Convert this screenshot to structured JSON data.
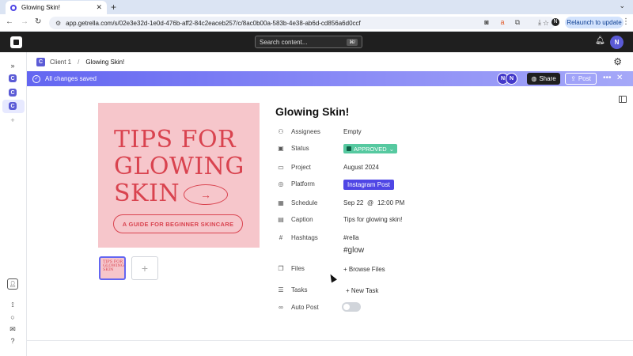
{
  "browser": {
    "tab_title": "Glowing Skin!",
    "url": "app.getrella.com/s/02e3e32d-1e0d-476b-aff2-84c2eaceb257/c/8ac0b00a-583b-4e38-ab6d-cd856a6d0ccf",
    "relaunch_label": "Relaunch to update",
    "profile_initial": "N"
  },
  "appbar": {
    "search_placeholder": "Search content...",
    "search_shortcut": "⌘/",
    "user_initial": "N"
  },
  "sidebar": {
    "items": [
      {
        "label": "C"
      },
      {
        "label": "C"
      },
      {
        "label": "C"
      }
    ],
    "add_label": "+"
  },
  "breadcrumb": {
    "workspace_initial": "C",
    "client": "Client 1",
    "separator": "/",
    "post": "Glowing Skin!"
  },
  "savedbar": {
    "text": "All changes saved",
    "avatars": [
      "N",
      "N"
    ],
    "share_label": "Share",
    "post_label": "Post"
  },
  "poster": {
    "headline": "TIPS FOR GLOWING SKIN",
    "subtitle": "A GUIDE FOR BEGINNER SKINCARE",
    "thumb_text": "TIPS FOR GLOWING SKIN"
  },
  "post": {
    "title": "Glowing Skin!",
    "fields": {
      "assignees": {
        "label": "Assignees",
        "value": "Empty"
      },
      "status": {
        "label": "Status",
        "value": "APPROVED"
      },
      "project": {
        "label": "Project",
        "value": "August 2024"
      },
      "platform": {
        "label": "Platform",
        "value": "Instagram Post"
      },
      "schedule": {
        "label": "Schedule",
        "date": "Sep 22",
        "at": "@",
        "time": "12:00 PM"
      },
      "caption": {
        "label": "Caption",
        "value": "Tips for glowing skin!"
      },
      "hashtags": {
        "label": "Hashtags",
        "values": [
          "#rella",
          "#glow"
        ]
      },
      "files": {
        "label": "Files",
        "value": "+ Browse Files"
      },
      "tasks": {
        "label": "Tasks",
        "value": "+ New Task"
      },
      "autopost": {
        "label": "Auto Post",
        "enabled": false
      }
    }
  },
  "colors": {
    "accent": "#5b5bd6",
    "status_green": "#56c9a0",
    "poster_bg": "#f6c6cb",
    "poster_text": "#d9434f"
  }
}
